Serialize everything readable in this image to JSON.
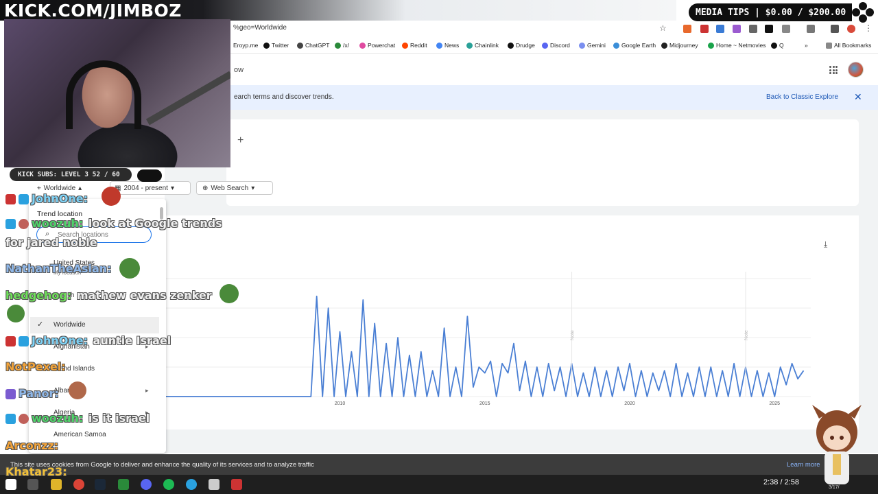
{
  "browser": {
    "url": "%geo=Worldwide",
    "bookmarks": [
      "Eroyp.me",
      "Twitter",
      "ChatGPT",
      "/x/",
      "Powerchat",
      "Reddit",
      "News",
      "Chainlink",
      "Drudge",
      "Discord",
      "Gemini",
      "Google Earth",
      "Midjourney",
      "Home ~ Netmovies",
      "Q",
      "All Bookmarks"
    ]
  },
  "trends": {
    "header_title": "ow",
    "banner_text": "earch terms and discover trends.",
    "classic_link": "Back to Classic Explore",
    "filters": {
      "location": "Worldwide",
      "time": "2004 - present",
      "search_type": "Web Search"
    },
    "location_dropdown": {
      "title": "Trend location",
      "search_placeholder": "Search locations",
      "items": [
        "United States",
        "My location",
        "th",
        "Worldwide",
        "Afghanistan",
        "Åland Islands",
        "Albania",
        "Algeria",
        "American Samoa"
      ],
      "selected": "Worldwide"
    }
  },
  "chart_data": {
    "type": "line",
    "x_ticks": [
      "2010",
      "2015",
      "2020",
      "2025"
    ],
    "annotations": [
      "Note",
      "Note"
    ],
    "series": [
      {
        "color": "#4a7fd4",
        "x": [
          2004.0,
          2005.0,
          2006.0,
          2007.0,
          2008.0,
          2009.0,
          2009.2,
          2009.4,
          2009.6,
          2009.8,
          2010.0,
          2010.2,
          2010.4,
          2010.6,
          2010.8,
          2011.0,
          2011.2,
          2011.4,
          2011.6,
          2011.8,
          2012.0,
          2012.2,
          2012.4,
          2012.6,
          2012.8,
          2013.0,
          2013.2,
          2013.4,
          2013.6,
          2013.8,
          2014.0,
          2014.2,
          2014.4,
          2014.6,
          2014.8,
          2015.0,
          2015.2,
          2015.4,
          2015.6,
          2015.8,
          2016.0,
          2016.2,
          2016.4,
          2016.6,
          2016.8,
          2017.0,
          2017.2,
          2017.4,
          2017.6,
          2017.8,
          2018.0,
          2018.2,
          2018.4,
          2018.6,
          2018.8,
          2019.0,
          2019.2,
          2019.4,
          2019.6,
          2019.8,
          2020.0,
          2020.2,
          2020.4,
          2020.6,
          2020.8,
          2021.0,
          2021.2,
          2021.4,
          2021.6,
          2021.8,
          2022.0,
          2022.2,
          2022.4,
          2022.6,
          2022.8,
          2023.0,
          2023.2,
          2023.4,
          2023.6,
          2023.8,
          2024.0,
          2024.2,
          2024.4,
          2024.6,
          2024.8,
          2025.0,
          2025.2,
          2025.4,
          2025.6,
          2025.8,
          2026.0
        ],
        "y": [
          0,
          0,
          0,
          0,
          0,
          0,
          85,
          0,
          75,
          0,
          55,
          0,
          38,
          0,
          82,
          0,
          62,
          0,
          45,
          0,
          50,
          0,
          35,
          0,
          38,
          0,
          22,
          0,
          58,
          0,
          25,
          0,
          68,
          8,
          25,
          20,
          30,
          0,
          28,
          20,
          45,
          5,
          30,
          0,
          25,
          0,
          28,
          5,
          25,
          0,
          28,
          0,
          20,
          0,
          25,
          0,
          22,
          0,
          25,
          5,
          28,
          0,
          22,
          0,
          20,
          5,
          22,
          0,
          28,
          0,
          20,
          0,
          25,
          0,
          25,
          0,
          22,
          0,
          28,
          0,
          25,
          0,
          22,
          0,
          20,
          0,
          25,
          10,
          28,
          15,
          22
        ]
      }
    ],
    "ylim": [
      0,
      100
    ]
  },
  "cookie": {
    "text": "This site uses cookies from Google to deliver and enhance the quality of its services and to analyze traffic",
    "learn_more": "Learn more"
  },
  "taskbar": {
    "clock": "2:38 / 2:58",
    "date": "3/17/"
  },
  "stream": {
    "kick_url": "KICK.COM/JIMBOZ",
    "media_tips": "MEDIA TIPS | $0.00 / $200.00",
    "subs": "KICK SUBS: LEVEL 3 52 / 60",
    "chat": [
      {
        "user": "JohnOne:",
        "color": "#7fd3f7",
        "msg": ""
      },
      {
        "user": "woozuh:",
        "color": "#4fd36a",
        "msg": "look at Google trends"
      },
      {
        "user": "",
        "color": "#fff",
        "msg": "for jared noble"
      },
      {
        "user": "NathanTheAsian:",
        "color": "#8fb7e8",
        "msg": ""
      },
      {
        "user": "hedgehog:",
        "color": "#6fe05a",
        "msg": "mathew evans zenker"
      },
      {
        "user": "JohnOne:",
        "color": "#7fd3f7",
        "msg": "auntie Israel"
      },
      {
        "user": "NotPexel:",
        "color": "#f2a33a",
        "msg": ""
      },
      {
        "user": "Panor:",
        "color": "#8fb7e8",
        "msg": ""
      },
      {
        "user": "woozuh:",
        "color": "#4fd36a",
        "msg": "is it israel"
      },
      {
        "user": "Arconzz:",
        "color": "#f2a33a",
        "msg": ""
      },
      {
        "user": "Khatar23:",
        "color": "#f2c13a",
        "msg": ""
      }
    ]
  },
  "colors": {
    "accent": "#1a73e8",
    "chart_line": "#4a7fd4",
    "banner_bg": "#e8f0fe"
  }
}
